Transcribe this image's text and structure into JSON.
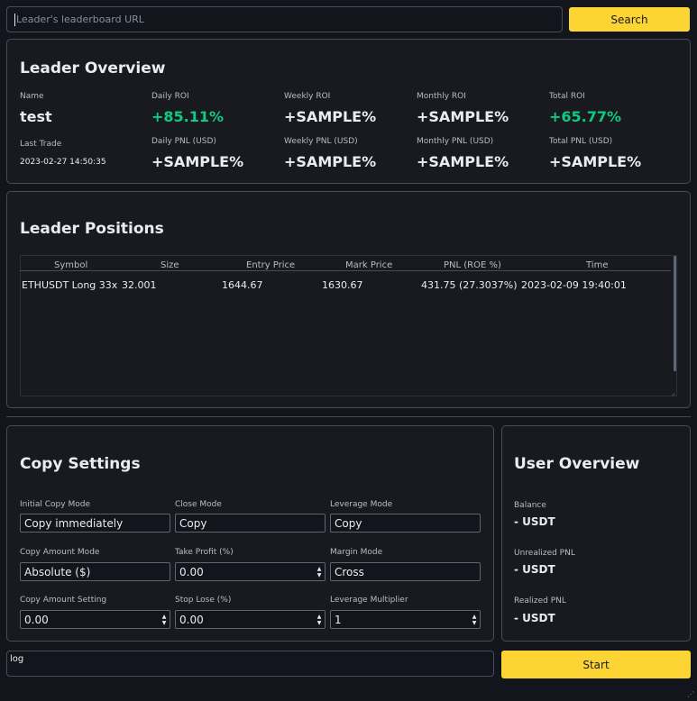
{
  "search": {
    "placeholder": "Leader's leaderboard URL",
    "button_label": "Search"
  },
  "leader_overview": {
    "title": "Leader Overview",
    "name_label": "Name",
    "name_value": "test",
    "last_trade_label": "Last Trade",
    "last_trade_value": "2023-02-27 14:50:35",
    "daily_roi_label": "Daily ROI",
    "daily_roi_value": "+85.11%",
    "weekly_roi_label": "Weekly ROI",
    "weekly_roi_value": "+SAMPLE%",
    "monthly_roi_label": "Monthly ROI",
    "monthly_roi_value": "+SAMPLE%",
    "total_roi_label": "Total ROI",
    "total_roi_value": "+65.77%",
    "daily_pnl_label": "Daily PNL (USD)",
    "daily_pnl_value": "+SAMPLE%",
    "weekly_pnl_label": "Weekly PNL (USD)",
    "weekly_pnl_value": "+SAMPLE%",
    "monthly_pnl_label": "Monthly PNL (USD)",
    "monthly_pnl_value": "+SAMPLE%",
    "total_pnl_label": "Total PNL (USD)",
    "total_pnl_value": "+SAMPLE%"
  },
  "leader_positions": {
    "title": "Leader Positions",
    "columns": [
      "Symbol",
      "Size",
      "Entry Price",
      "Mark Price",
      "PNL (ROE %)",
      "Time"
    ],
    "rows": [
      {
        "symbol": "ETHUSDT Long 33x",
        "size": "32.001",
        "entry_price": "1644.67",
        "mark_price": "1630.67",
        "pnl": "431.75 (27.3037%)",
        "time": "2023-02-09 19:40:01"
      }
    ]
  },
  "copy_settings": {
    "title": "Copy Settings",
    "initial_copy_mode_label": "Initial Copy Mode",
    "initial_copy_mode_value": "Copy immediately",
    "close_mode_label": "Close Mode",
    "close_mode_value": "Copy",
    "leverage_mode_label": "Leverage Mode",
    "leverage_mode_value": "Copy",
    "copy_amount_mode_label": "Copy Amount Mode",
    "copy_amount_mode_value": "Absolute ($)",
    "take_profit_label": "Take Profit (%)",
    "take_profit_value": "0.00",
    "margin_mode_label": "Margin Mode",
    "margin_mode_value": "Cross",
    "copy_amount_setting_label": "Copy Amount Setting",
    "copy_amount_setting_value": "0.00",
    "stop_lose_label": "Stop Lose (%)",
    "stop_lose_value": "0.00",
    "leverage_multiplier_label": "Leverage Multiplier",
    "leverage_multiplier_value": "1"
  },
  "user_overview": {
    "title": "User Overview",
    "balance_label": "Balance",
    "balance_value": "- USDT",
    "unrealized_label": "Unrealized PNL",
    "unrealized_value": "- USDT",
    "realized_label": "Realized PNL",
    "realized_value": "- USDT"
  },
  "log": {
    "text": "log"
  },
  "start_button_label": "Start",
  "colors": {
    "background": "#12161c",
    "panel": "#181a20",
    "accent_yellow": "#fcd535",
    "positive_green": "#0ecb81",
    "border": "#474d57"
  }
}
